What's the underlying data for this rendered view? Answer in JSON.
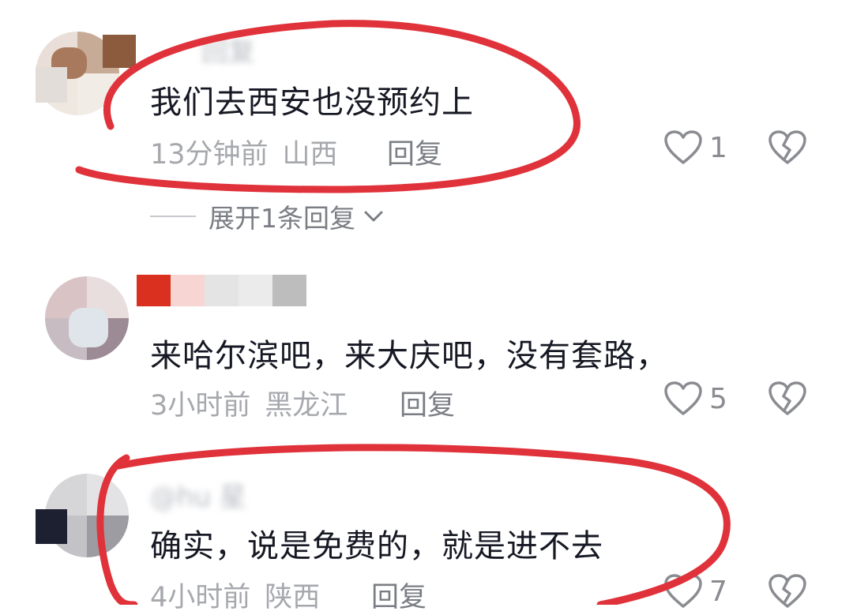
{
  "comments": [
    {
      "username": "回复",
      "text": "我们去西安也没预约上",
      "time": "13分钟前",
      "location": "山西",
      "reply_label": "回复",
      "likes": "1",
      "expand_label": "展开1条回复"
    },
    {
      "username": "",
      "text": "来哈尔滨吧，来大庆吧，没有套路，",
      "time": "3小时前",
      "location": "黑龙江",
      "reply_label": "回复",
      "likes": "5"
    },
    {
      "username": "@hu  星",
      "text": "确实，说是免费的，就是进不去",
      "time": "4小时前",
      "location": "陕西",
      "reply_label": "回复",
      "likes": "7"
    }
  ],
  "colors": {
    "text": "#161823",
    "meta": "#a6a8ad",
    "reply": "#7a7d83",
    "annotation_red": "#e0323a"
  },
  "icons": {
    "like": "heart-outline-icon",
    "dislike": "broken-heart-icon",
    "expand": "chevron-down-icon"
  }
}
